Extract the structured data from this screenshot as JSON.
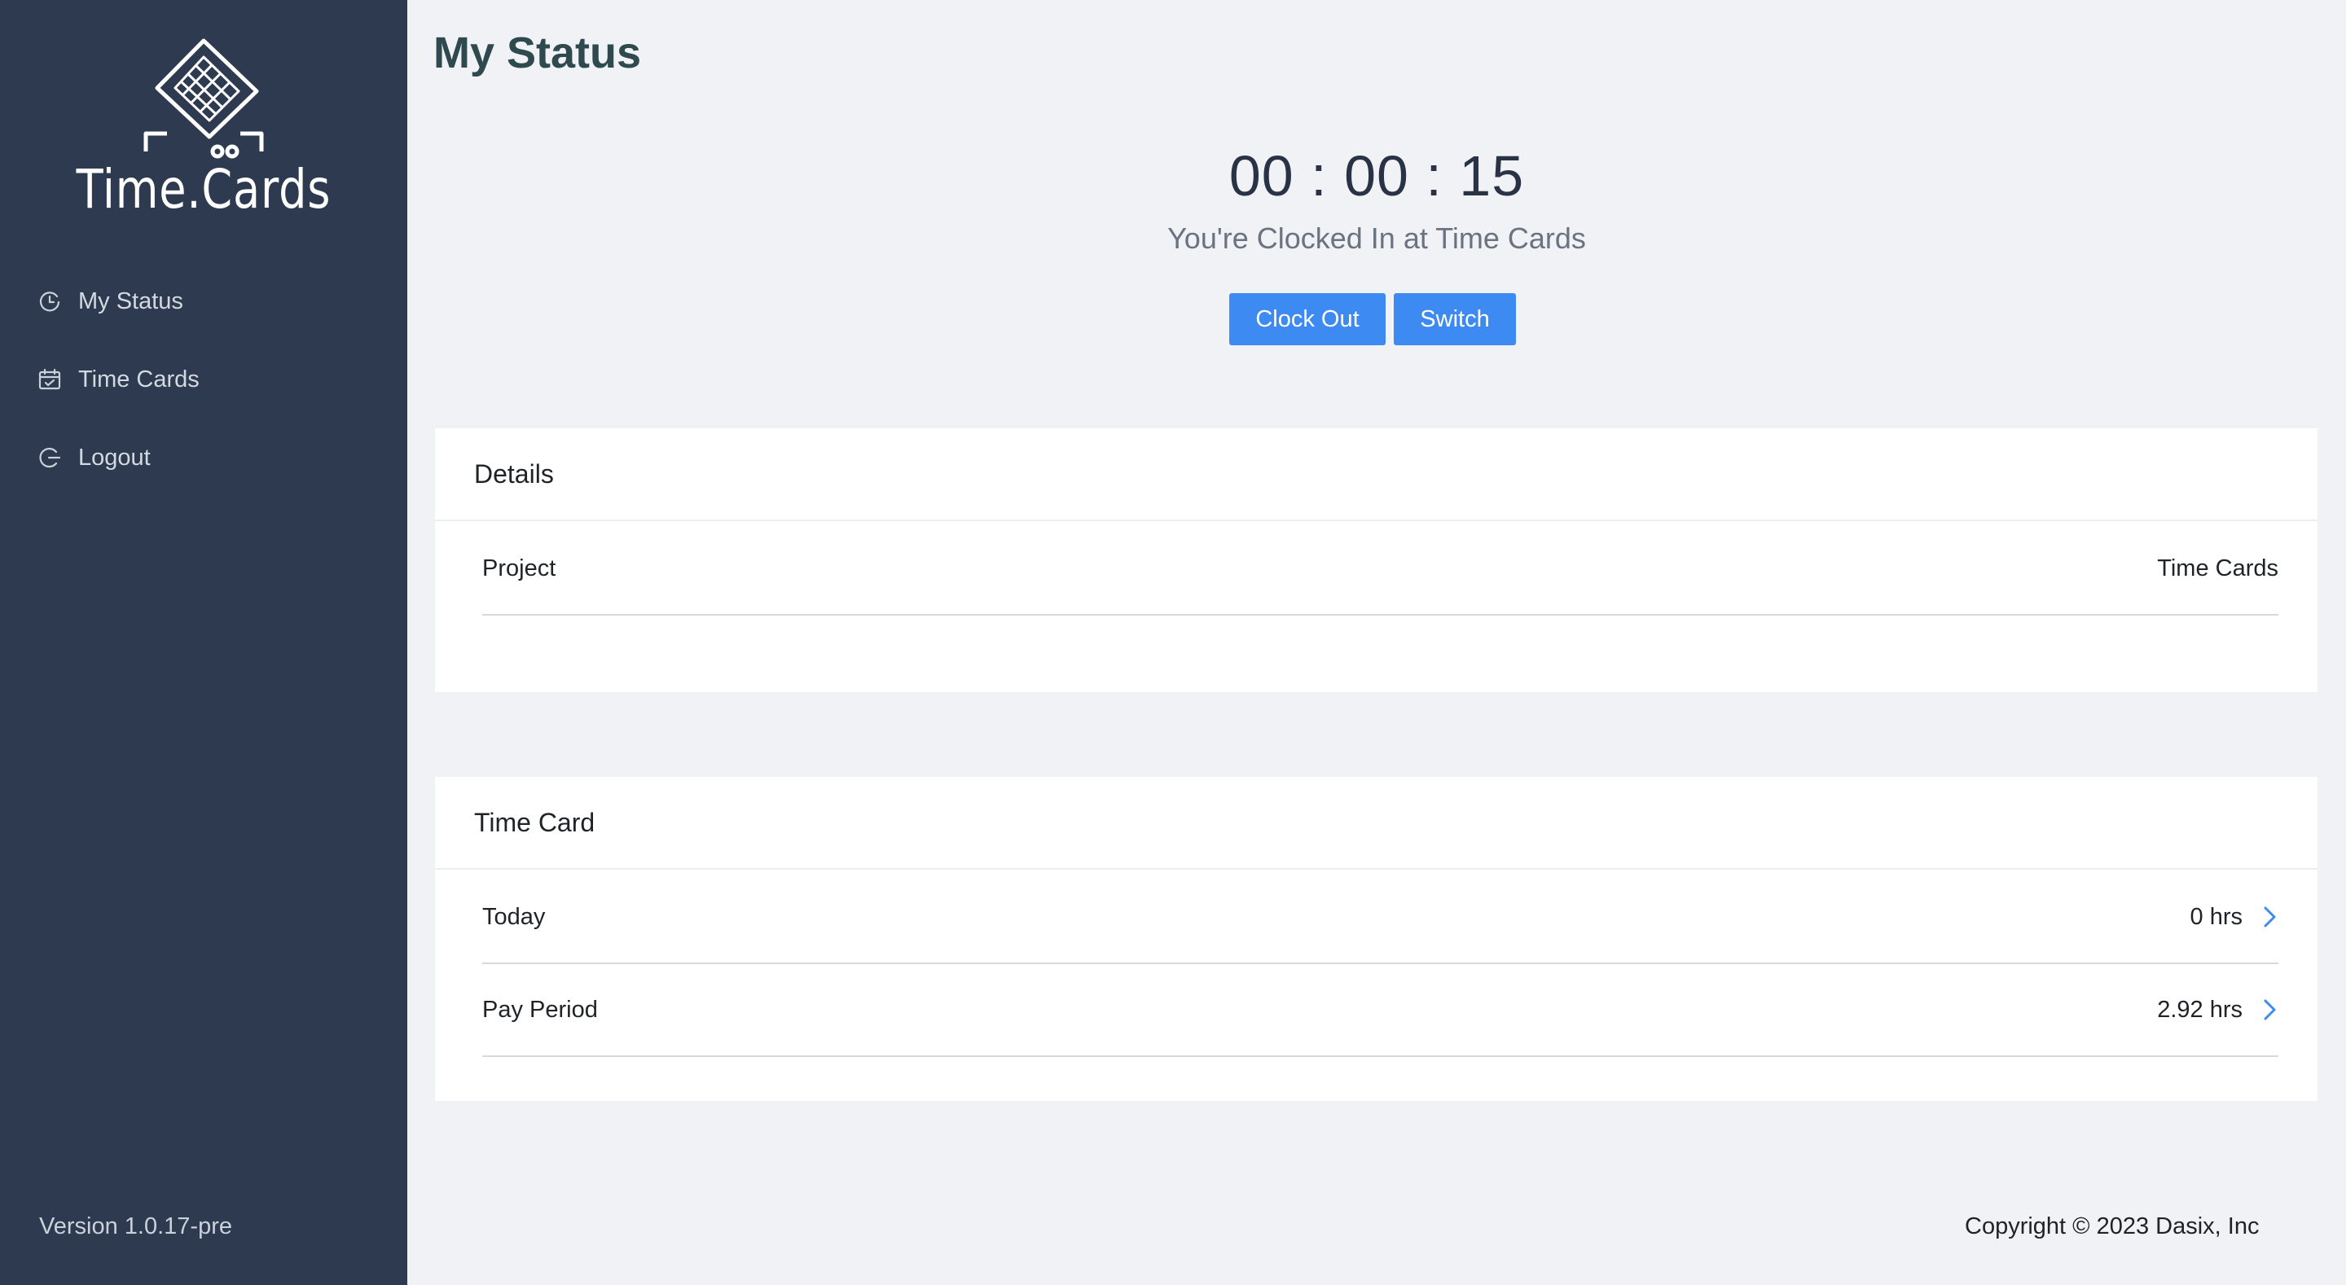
{
  "sidebar": {
    "logo_text": "Time.Cards",
    "items": [
      {
        "label": "My Status",
        "icon": "status-clock-icon"
      },
      {
        "label": "Time Cards",
        "icon": "calendar-icon"
      },
      {
        "label": "Logout",
        "icon": "logout-icon"
      }
    ],
    "version": "Version 1.0.17-pre"
  },
  "main": {
    "title": "My Status",
    "timer": "00 : 00 : 15",
    "status": "You're Clocked In at Time Cards",
    "buttons": {
      "clock_out": "Clock Out",
      "switch": "Switch"
    },
    "details": {
      "title": "Details",
      "rows": [
        {
          "label": "Project",
          "value": "Time Cards"
        }
      ]
    },
    "time_card": {
      "title": "Time Card",
      "rows": [
        {
          "label": "Today",
          "value": "0 hrs"
        },
        {
          "label": "Pay Period",
          "value": "2.92 hrs"
        }
      ]
    }
  },
  "footer": {
    "copyright": "Copyright © 2023 Dasix, Inc"
  },
  "colors": {
    "sidebar": "#2d3a4f",
    "accent": "#3d8bf2",
    "background": "#f0f2f5"
  }
}
